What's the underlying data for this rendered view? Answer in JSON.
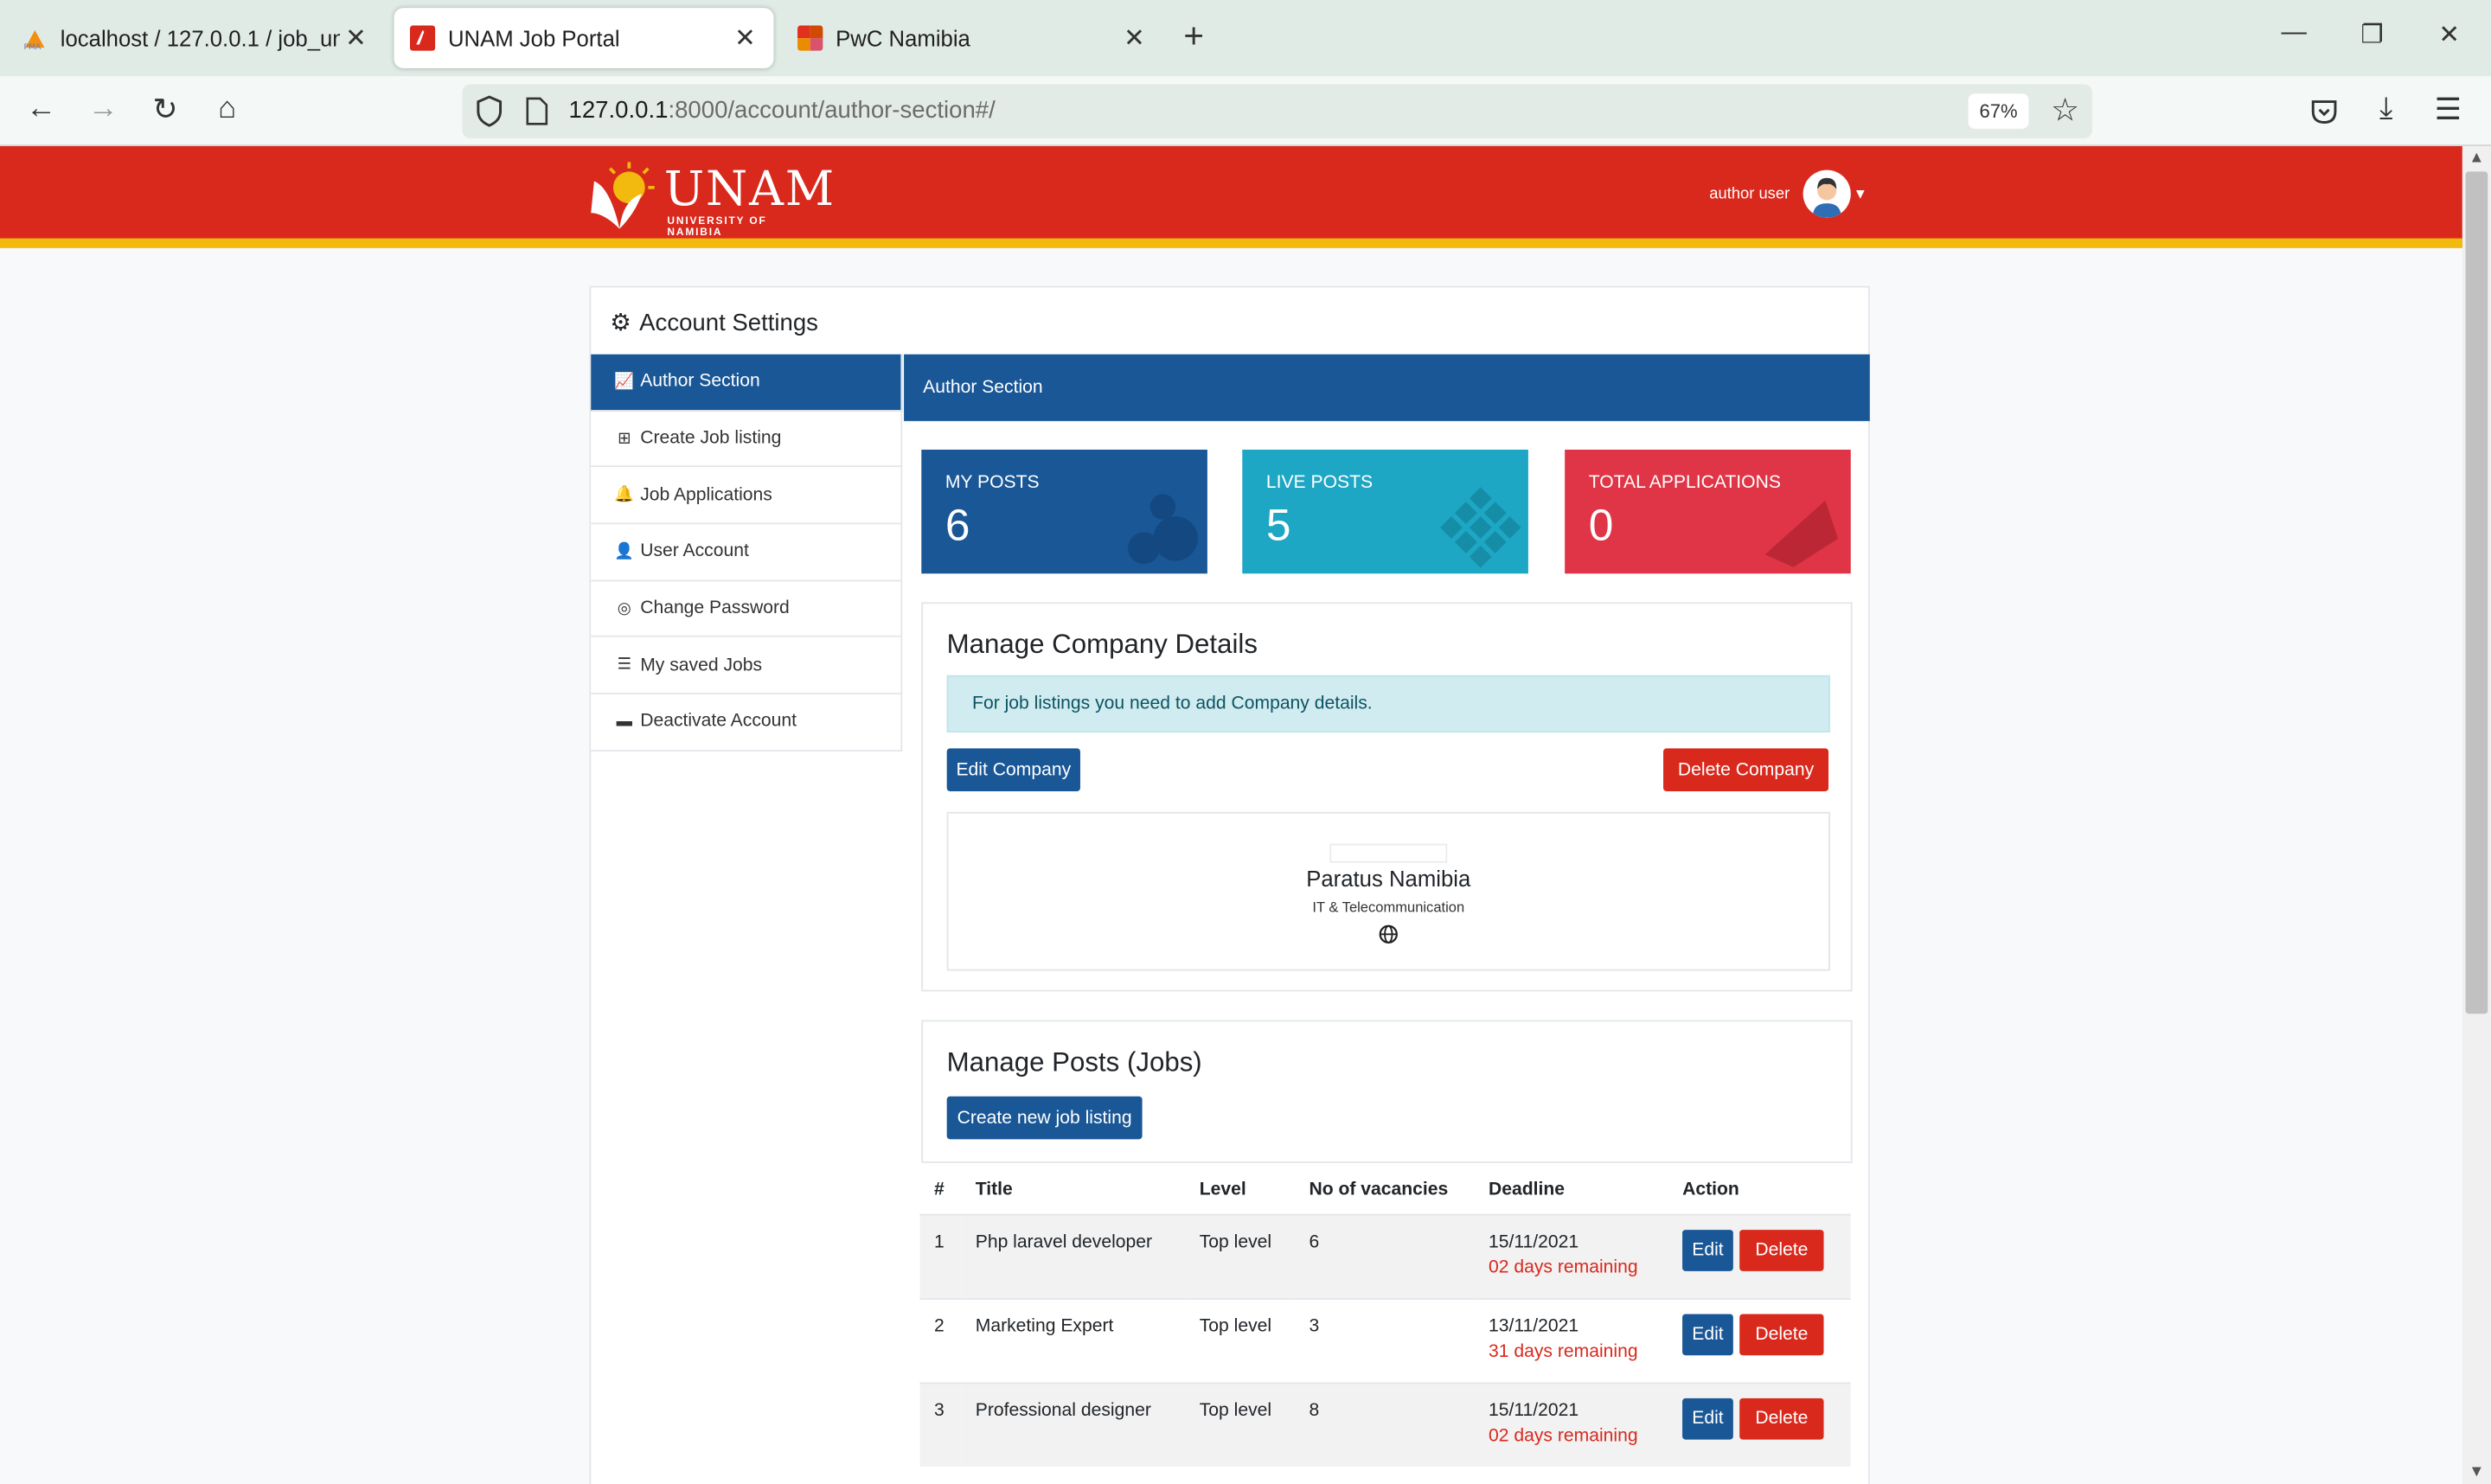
{
  "browser": {
    "tabs": [
      {
        "title": "localhost / 127.0.0.1 / job_unam",
        "active": false
      },
      {
        "title": "UNAM Job Portal",
        "active": true
      },
      {
        "title": "PwC Namibia",
        "active": false
      }
    ],
    "url_host": "127.0.0.1",
    "url_rest": ":8000/account/author-section#/",
    "zoom": "67%"
  },
  "header": {
    "logo_text": "UNAM",
    "logo_sub": "UNIVERSITY OF NAMIBIA",
    "user_name": "author user",
    "brand_color": "#d9291d",
    "accent_color": "#f2b90f"
  },
  "settings": {
    "title": "Account Settings",
    "nav": [
      {
        "label": "Author Section",
        "icon": "chart-line-icon",
        "active": true
      },
      {
        "label": "Create Job listing",
        "icon": "plus-square-icon"
      },
      {
        "label": "Job Applications",
        "icon": "bell-icon"
      },
      {
        "label": "User Account",
        "icon": "user-cog-icon"
      },
      {
        "label": "Change Password",
        "icon": "fingerprint-icon"
      },
      {
        "label": "My saved Jobs",
        "icon": "list-icon"
      },
      {
        "label": "Deactivate Account",
        "icon": "folder-icon"
      }
    ]
  },
  "author_section": {
    "title": "Author Section",
    "stats": [
      {
        "label": "MY POSTS",
        "value": "6",
        "color": "#1a5796"
      },
      {
        "label": "LIVE POSTS",
        "value": "5",
        "color": "#1ea7c5"
      },
      {
        "label": "TOTAL APPLICATIONS",
        "value": "0",
        "color": "#e03546"
      }
    ]
  },
  "company": {
    "heading": "Manage Company Details",
    "alert": "For job listings you need to add Company details.",
    "edit_label": "Edit Company",
    "delete_label": "Delete Company",
    "name": "Paratus Namibia",
    "industry": "IT & Telecommunication"
  },
  "posts": {
    "heading": "Manage Posts (Jobs)",
    "create_label": "Create new job listing",
    "columns": [
      "#",
      "Title",
      "Level",
      "No of vacancies",
      "Deadline",
      "Action"
    ],
    "rows": [
      {
        "num": "1",
        "title": "Php laravel developer",
        "level": "Top level",
        "vacancies": "6",
        "deadline": "15/11/2021",
        "remaining": "02 days remaining"
      },
      {
        "num": "2",
        "title": "Marketing Expert",
        "level": "Top level",
        "vacancies": "3",
        "deadline": "13/11/2021",
        "remaining": "31 days remaining"
      },
      {
        "num": "3",
        "title": "Professional designer",
        "level": "Top level",
        "vacancies": "8",
        "deadline": "15/11/2021",
        "remaining": "02 days remaining"
      }
    ],
    "edit_label": "Edit",
    "delete_label": "Delete"
  }
}
